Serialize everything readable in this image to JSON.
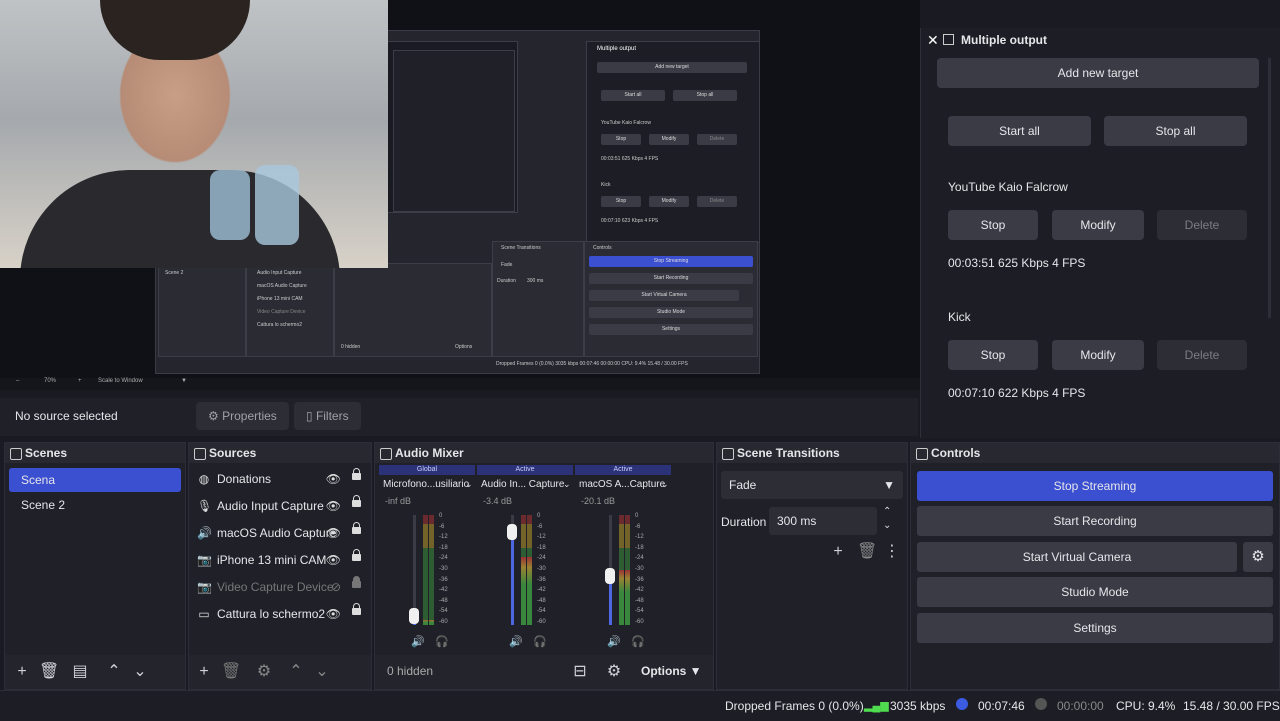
{
  "preview": {
    "zoom_label": "70%",
    "scale_label": "Scale to Window",
    "minus_label": "–",
    "plus_label": "+",
    "mini": {
      "multi_title": "Multiple output",
      "add_target": "Add new target",
      "start_all": "Start all",
      "stop_all": "Stop all",
      "yt": "YouTube Kaio Falcrow",
      "stop": "Stop",
      "modify": "Modify",
      "delete": "Delete",
      "yt_stats": "00:03:51  625 Kbps  4 FPS",
      "kick": "Kick",
      "kick_stats": "00:07:10  623 Kbps  4 FPS",
      "transitions": "Scene Transitions",
      "controls": "Controls",
      "fade": "Fade",
      "duration": "Duration",
      "duration_val": "300 ms",
      "stop_streaming": "Stop Streaming",
      "start_recording": "Start Recording",
      "start_virtual": "Start Virtual Camera",
      "studio_mode": "Studio Mode",
      "settings": "Settings",
      "scene2": "Scene 2",
      "src1": "Audio Input Capture",
      "src2": "macOS Audio Capture",
      "src3": "iPhone 13 mini CAM",
      "src4": "Video Capture Device",
      "src5": "Cattura lo schermo2",
      "hidden": "0 hidden",
      "options": "Options",
      "status": "Dropped Frames 0 (0.0%)   3035 kbps   00:07:46   00:00:00   CPU: 9.4%   15.48 / 30.00 FPS"
    }
  },
  "multi_output": {
    "title": "Multiple output",
    "add_target": "Add new target",
    "start_all": "Start all",
    "stop_all": "Stop all",
    "targets": [
      {
        "name": "YouTube Kaio Falcrow",
        "stop": "Stop",
        "modify": "Modify",
        "delete": "Delete",
        "stats": "00:03:51  625 Kbps  4 FPS"
      },
      {
        "name": "Kick",
        "stop": "Stop",
        "modify": "Modify",
        "delete": "Delete",
        "stats": "00:07:10  622 Kbps  4 FPS"
      }
    ]
  },
  "context": {
    "no_source": "No source selected",
    "properties": "Properties",
    "filters": "Filters"
  },
  "scenes": {
    "title": "Scenes",
    "items": [
      "Scena",
      "Scene 2"
    ]
  },
  "sources": {
    "title": "Sources",
    "items": [
      {
        "label": "Donations",
        "icon": "browser-icon"
      },
      {
        "label": "Audio Input Capture",
        "icon": "microphone-icon"
      },
      {
        "label": "macOS Audio Capture",
        "icon": "speaker-icon"
      },
      {
        "label": "iPhone 13 mini CAM",
        "icon": "camera-icon"
      },
      {
        "label": "Video Capture Device",
        "icon": "camera-icon"
      },
      {
        "label": "Cattura lo schermo2",
        "icon": "monitor-icon"
      }
    ]
  },
  "mixer": {
    "title": "Audio Mixer",
    "channels": [
      {
        "badge": "Global",
        "name": "Microfono...usiliario",
        "db": "-inf dB",
        "level": 0.05,
        "volume": 0.08
      },
      {
        "badge": "Active",
        "name": "Audio In... Capture",
        "db": "-3.4 dB",
        "level": 0.62,
        "volume": 0.85
      },
      {
        "badge": "Active",
        "name": "macOS A...Capture",
        "db": "-20.1 dB",
        "level": 0.5,
        "volume": 0.45
      }
    ],
    "ticks": [
      "0",
      "-6",
      "-12",
      "-18",
      "-24",
      "-30",
      "-36",
      "-42",
      "-48",
      "-54",
      "-60"
    ],
    "hidden": "0 hidden",
    "options": "Options"
  },
  "transitions": {
    "title": "Scene Transitions",
    "selected": "Fade",
    "duration_label": "Duration",
    "duration_value": "300 ms"
  },
  "controls": {
    "title": "Controls",
    "stop_streaming": "Stop Streaming",
    "start_recording": "Start Recording",
    "start_virtual_camera": "Start Virtual Camera",
    "studio_mode": "Studio Mode",
    "settings": "Settings"
  },
  "status": {
    "dropped": "Dropped Frames 0 (0.0%)",
    "bitrate": "3035 kbps",
    "stream_time": "00:07:46",
    "rec_time": "00:00:00",
    "cpu": "CPU: 9.4%",
    "fps": "15.48 / 30.00 FPS"
  },
  "colors": {
    "accent": "#3b4fd1",
    "background": "#1f2028"
  }
}
